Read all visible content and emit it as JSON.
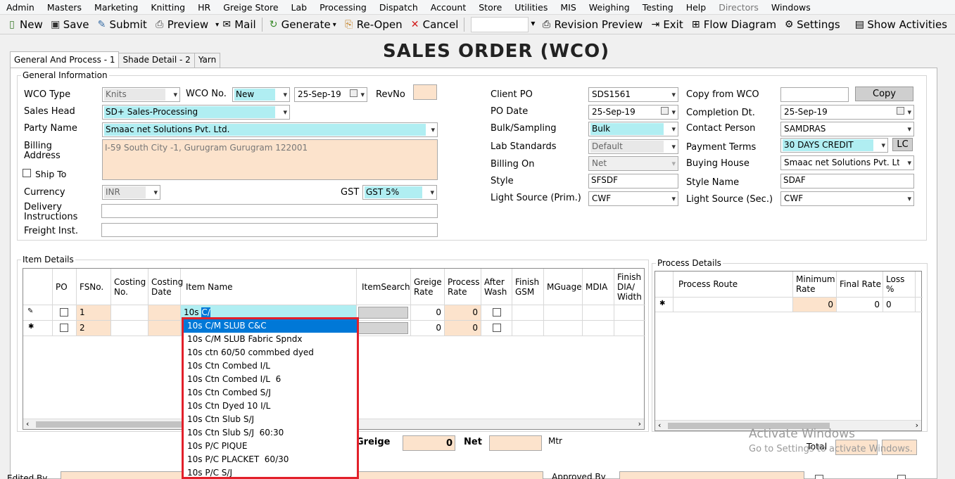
{
  "menu": [
    "Admin",
    "Masters",
    "Marketing",
    "Knitting",
    "HR",
    "Greige Store",
    "Lab",
    "Processing",
    "Dispatch",
    "Account",
    "Store",
    "Utilities",
    "MIS",
    "Weighing",
    "Testing",
    "Help",
    "Directors",
    "Windows"
  ],
  "toolbar": {
    "new": "New",
    "save": "Save",
    "submit": "Submit",
    "preview": "Preview",
    "mail": "Mail",
    "generate": "Generate",
    "reopen": "Re-Open",
    "cancel": "Cancel",
    "revision_preview": "Revision Preview",
    "exit": "Exit",
    "flow_diagram": "Flow Diagram",
    "settings": "Settings",
    "show_activities": "Show Activities"
  },
  "title": "SALES ORDER (WCO)",
  "tabs": [
    "General And Process - 1",
    "Shade Detail - 2",
    "Yarn"
  ],
  "general": {
    "group_title": "General Information",
    "wco_type_label": "WCO Type",
    "wco_type": "Knits",
    "wco_no_label": "WCO No.",
    "wco_no": "New",
    "wco_date": "25-Sep-19",
    "revno_label": "RevNo",
    "sales_head_label": "Sales Head",
    "sales_head": "SD+ Sales-Processing",
    "party_name_label": "Party Name",
    "party_name": "Smaac net Solutions Pvt. Ltd.",
    "billing_address_label": "Billing Address",
    "billing_address": "I-59 South City -1, Gurugram Gurugram 122001",
    "ship_to_label": "Ship To",
    "currency_label": "Currency",
    "currency": "INR",
    "gst_label": "GST",
    "gst": "GST 5%",
    "delivery_label": "Delivery Instructions",
    "freight_label": "Freight Inst.",
    "client_po_label": "Client PO",
    "client_po": "SDS1561",
    "po_date_label": "PO Date",
    "po_date": "25-Sep-19",
    "bulk_label": "Bulk/Sampling",
    "bulk": "Bulk",
    "lab_label": "Lab Standards",
    "lab": "Default",
    "billing_on_label": "Billing On",
    "billing_on": "Net",
    "style_label": "Style",
    "style": "SFSDF",
    "light_prim_label": "Light Source (Prim.)",
    "light_prim": "CWF",
    "copy_from_label": "Copy from WCO",
    "copy_button": "Copy",
    "completion_label": "Completion Dt.",
    "completion": "25-Sep-19",
    "contact_label": "Contact Person",
    "contact": "SAMDRAS",
    "payment_label": "Payment Terms",
    "payment": "30 DAYS CREDIT",
    "lc_button": "LC",
    "buying_house_label": "Buying House",
    "buying_house": "Smaac net Solutions Pvt. Ltd.",
    "style_name_label": "Style Name",
    "style_name": "SDAF",
    "light_sec_label": "Light Source (Sec.)",
    "light_sec": "CWF"
  },
  "items": {
    "group_title": "Item Details",
    "headers": [
      "PO",
      "FSNo.",
      "Costing No.",
      "Costing Date",
      "Item Name",
      "ItemSearch",
      "Greige Rate",
      "Process Rate",
      "After Wash",
      "Finish GSM",
      "MGuage",
      "MDIA",
      "Finish DIA/ Width"
    ],
    "rows": [
      {
        "fsno": "1",
        "item_name": "10s ",
        "item_typed_sel": "C/",
        "greige_rate": "0",
        "process_rate": "0"
      },
      {
        "fsno": "2",
        "item_name": "",
        "item_typed_sel": "",
        "greige_rate": "0",
        "process_rate": "0"
      }
    ],
    "greige_label": "Greige",
    "greige_value": "0",
    "net_label": "Net",
    "mtr_label": "Mtr",
    "total_label": "Total"
  },
  "process": {
    "group_title": "Process Details",
    "headers": [
      "Process Route",
      "Minimum Rate",
      "Final Rate",
      "Loss %"
    ],
    "row": {
      "minimum_rate": "0",
      "final_rate": "0",
      "loss": "0"
    }
  },
  "dropdown_items": [
    "10s C/M SLUB C&C",
    "10s C/M SLUB Fabric Spndx",
    "10s ctn 60/50 commbed dyed",
    "10s Ctn Combed I/L",
    "10s Ctn Combed I/L  6",
    "10s Ctn Combed S/J",
    "10s Ctn Dyed 10 I/L",
    "10s Ctn Slub S/J",
    "10s Ctn Slub S/J  60:30",
    "10s P/C PIQUE",
    "10s P/C PLACKET  60/30",
    "10s P/C S/J"
  ],
  "footer": {
    "edited_by_label": "Edited By",
    "approved_by_label": "Approved By"
  },
  "watermark": {
    "line1": "Activate Windows",
    "line2": "Go to Settings to activate Windows."
  },
  "colors": {
    "peach": "#fce3cc",
    "cyan": "#b0eef2",
    "selection": "#0078d7",
    "highlight_border": "#e2202a"
  }
}
